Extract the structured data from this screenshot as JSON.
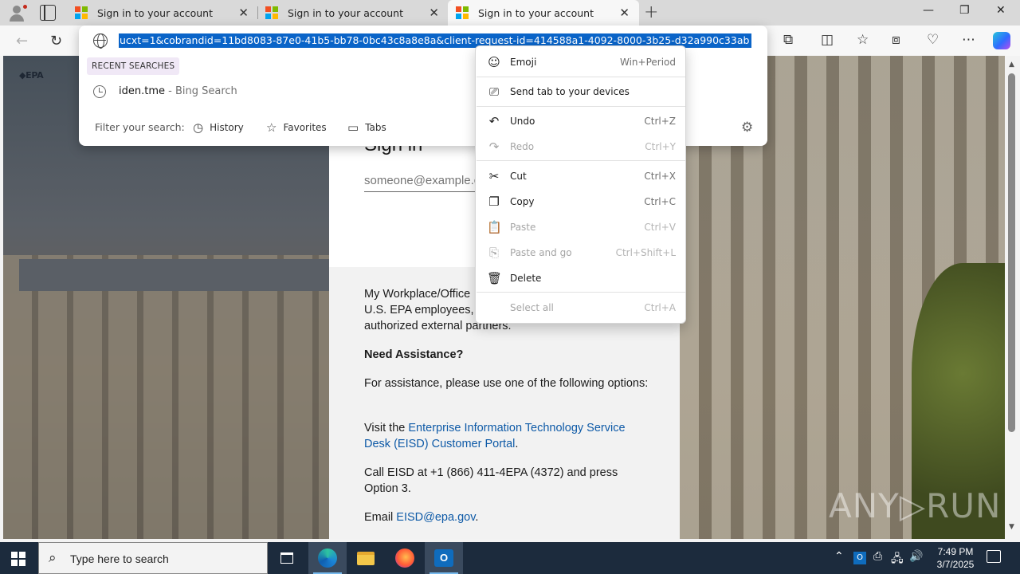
{
  "browser": {
    "tabs": [
      {
        "title": "Sign in to your account"
      },
      {
        "title": "Sign in to your account"
      },
      {
        "title": "Sign in to your account"
      }
    ],
    "address_bar": {
      "url_text": "ucxt=1&cobrandid=11bd8083-87e0-41b5-bb78-0bc43c8a8e8a&client-request-id=414588a1-4092-8000-3b25-d32a990c33ab"
    },
    "dropdown": {
      "recent_label": "RECENT SEARCHES",
      "suggestion_query": "iden.tme",
      "suggestion_source": " - Bing Search",
      "filter_label": "Filter your search:",
      "filters": [
        "History",
        "Favorites",
        "Tabs"
      ]
    },
    "context_menu": {
      "items": [
        {
          "label": "Emoji",
          "shortcut": "Win+Period",
          "enabled": true
        },
        {
          "label": "Send tab to your devices",
          "shortcut": "",
          "enabled": true
        },
        {
          "label": "Undo",
          "shortcut": "Ctrl+Z",
          "enabled": true
        },
        {
          "label": "Redo",
          "shortcut": "Ctrl+Y",
          "enabled": false
        },
        {
          "label": "Cut",
          "shortcut": "Ctrl+X",
          "enabled": true
        },
        {
          "label": "Copy",
          "shortcut": "Ctrl+C",
          "enabled": true
        },
        {
          "label": "Paste",
          "shortcut": "Ctrl+V",
          "enabled": false
        },
        {
          "label": "Paste and go",
          "shortcut": "Ctrl+Shift+L",
          "enabled": false
        },
        {
          "label": "Delete",
          "shortcut": "",
          "enabled": true
        },
        {
          "label": "Select all",
          "shortcut": "Ctrl+A",
          "enabled": false
        }
      ]
    }
  },
  "page": {
    "logo_text": "◆EPA",
    "signin_title": "Sign in",
    "email_placeholder": "someone@example.com",
    "intro_lines": [
      "My Workplace/Office",
      "U.S. EPA employees, a",
      "authorized external partners."
    ],
    "assist_heading": "Need Assistance?",
    "assist_text": "For assistance, please use one of the following options:",
    "visit_prefix": "Visit the ",
    "visit_link": "Enterprise Information Technology Service Desk (EISD) Customer Portal",
    "visit_suffix": ".",
    "call_text": "Call EISD at +1 (866) 411-4EPA (4372) and press Option 3.",
    "email_prefix": "Email ",
    "email_link": "EISD@epa.gov",
    "email_suffix": "."
  },
  "watermark": "ANY▷RUN",
  "taskbar": {
    "search_placeholder": "Type here to search",
    "time": "7:49 PM",
    "date": "3/7/2025"
  }
}
